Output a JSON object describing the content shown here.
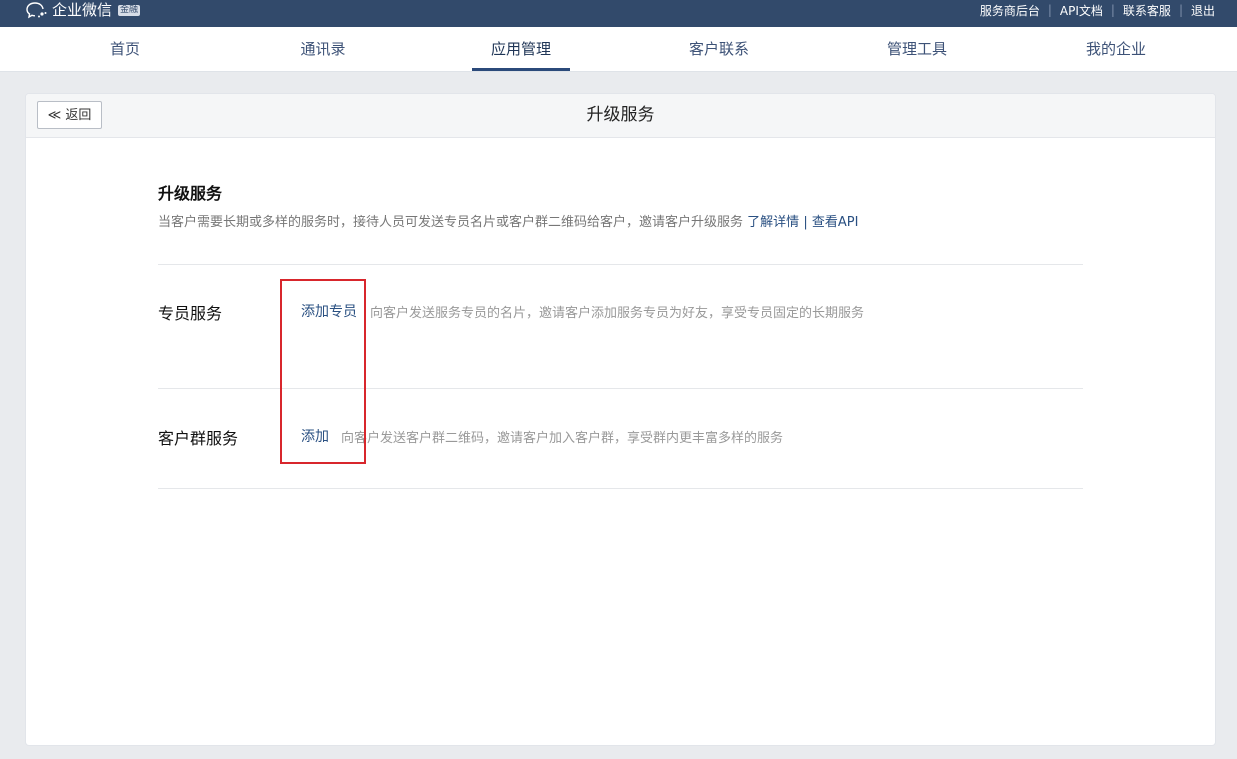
{
  "brand": {
    "name": "企业微信",
    "badge": "金融"
  },
  "top_links": [
    "服务商后台",
    "API文档",
    "联系客服",
    "退出"
  ],
  "nav": {
    "items": [
      "首页",
      "通讯录",
      "应用管理",
      "客户联系",
      "管理工具",
      "我的企业"
    ],
    "active": "应用管理"
  },
  "page": {
    "back_label": "≪ 返回",
    "header_title": "升级服务"
  },
  "section": {
    "title": "升级服务",
    "desc": "当客户需要长期或多样的服务时，接待人员可发送专员名片或客户群二维码给客户，邀请客户升级服务",
    "link_details": "了解详情",
    "link_sep": "|",
    "link_api": "查看API"
  },
  "rows": [
    {
      "label": "专员服务",
      "action": "添加专员",
      "desc": "向客户发送服务专员的名片，邀请客户添加服务专员为好友，享受专员固定的长期服务"
    },
    {
      "label": "客户群服务",
      "action": "添加",
      "desc": "向客户发送客户群二维码，邀请客户加入客户群，享受群内更丰富多样的服务"
    }
  ],
  "colors": {
    "topbar": "#324a6b",
    "link": "#2a5082",
    "highlight": "#d8262c"
  }
}
